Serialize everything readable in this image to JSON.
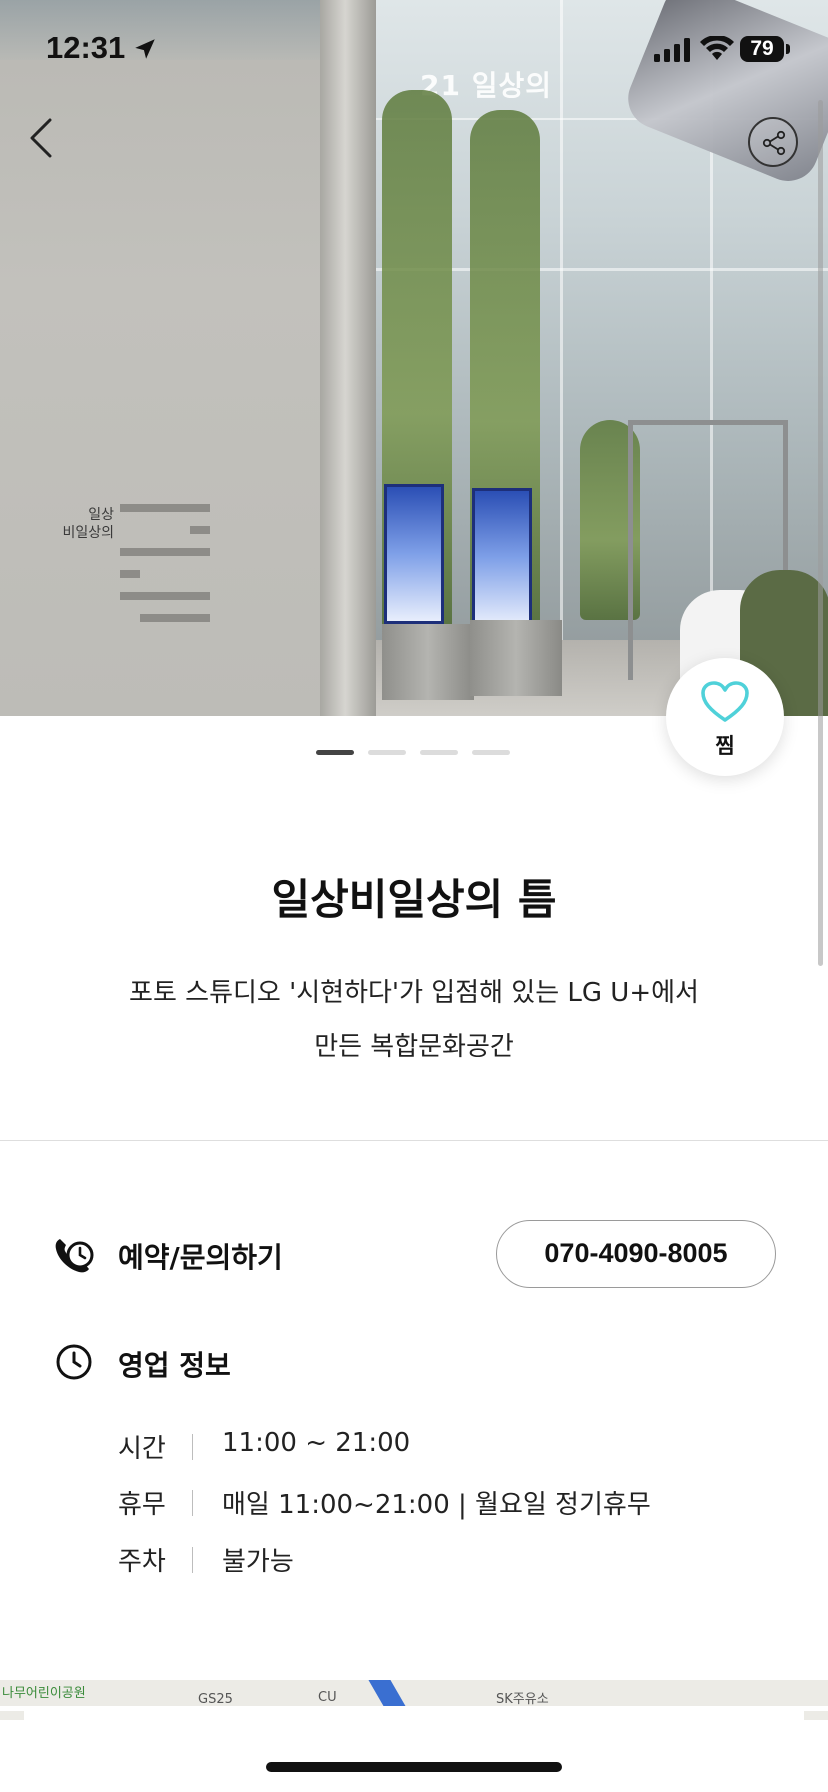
{
  "status_bar": {
    "time": "12:31",
    "battery": "79"
  },
  "hero": {
    "sign_line1": "일상",
    "sign_line2": "비일상의",
    "banner_text": "21 일상의",
    "pager": {
      "count": 4,
      "active_index": 0
    }
  },
  "icons": {
    "back": "chevron-left-icon",
    "share": "share-icon",
    "like": "heart-outline-icon",
    "reservation": "phone-clock-icon",
    "hours": "clock-icon",
    "accent_color": "#4fd1d9"
  },
  "like": {
    "label": "찜"
  },
  "place": {
    "title": "일상비일상의 틈",
    "description_line1": "포토 스튜디오 '시현하다'가 입점해 있는 LG U+에서",
    "description_line2": "만든 복합문화공간"
  },
  "reservation": {
    "heading": "예약/문의하기",
    "phone": "070-4090-8005"
  },
  "business_info": {
    "heading": "영업 정보",
    "rows": [
      {
        "key": "시간",
        "value": "11:00 ~ 21:00"
      },
      {
        "key": "휴무",
        "value": "매일 11:00~21:00 | 월요일 정기휴무"
      },
      {
        "key": "주차",
        "value": "불가능"
      }
    ]
  },
  "map": {
    "labels": [
      "나무어린이공원",
      "GS25",
      "CU",
      "SK주유소"
    ]
  }
}
